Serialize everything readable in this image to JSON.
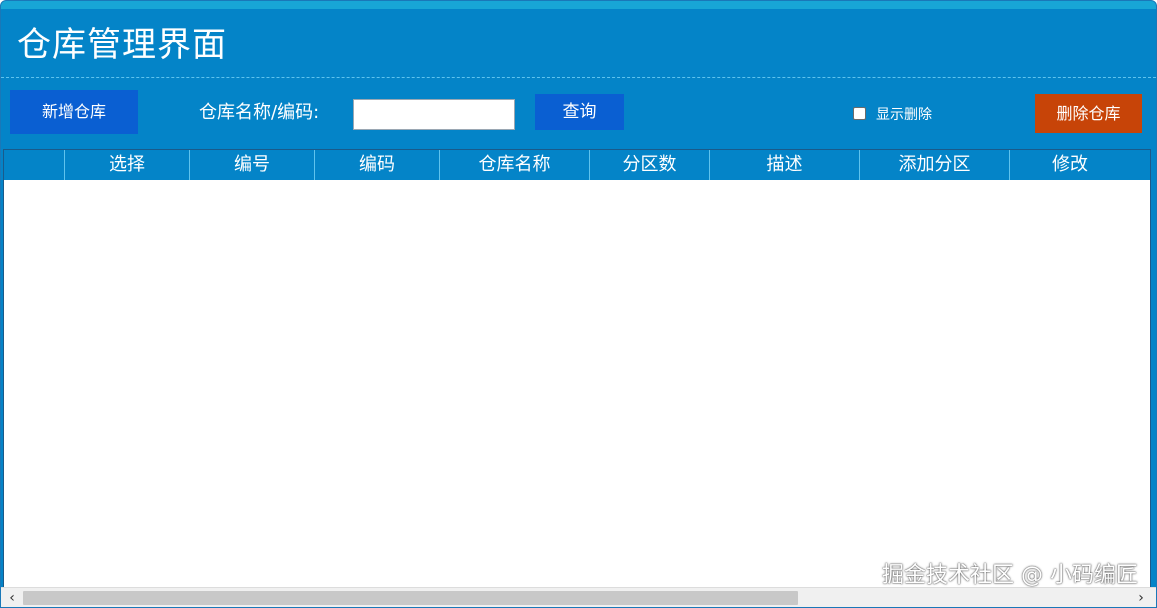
{
  "header": {
    "title": "仓库管理界面"
  },
  "toolbar": {
    "add_label": "新增仓库",
    "search_label": "仓库名称/编码:",
    "search_value": "",
    "query_label": "查询",
    "show_deleted_label": "显示删除",
    "show_deleted_checked": false,
    "delete_label": "删除仓库"
  },
  "table": {
    "columns": [
      "",
      "选择",
      "编号",
      "编码",
      "仓库名称",
      "分区数",
      "描述",
      "添加分区",
      "修改"
    ],
    "rows": []
  },
  "scrollbar": {
    "left_arrow": "‹",
    "right_arrow": "›"
  },
  "watermark": "掘金技术社区 @ 小码编匠",
  "colors": {
    "primary": "#0484c8",
    "button_blue": "#0a5fd2",
    "button_danger": "#c74408"
  }
}
